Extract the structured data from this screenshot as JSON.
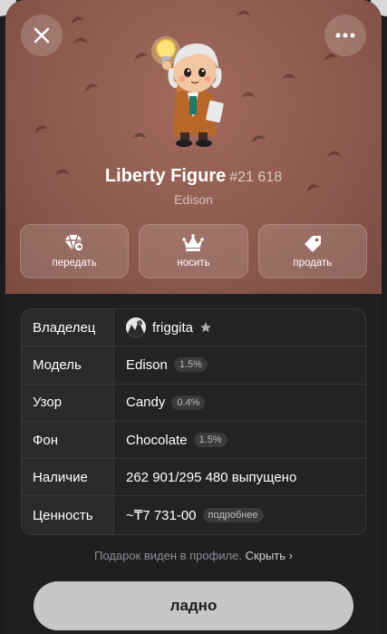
{
  "header": {
    "close_icon": "close-icon",
    "more_icon": "more-horizontal-icon"
  },
  "gift": {
    "title": "Liberty Figure",
    "number": "#21 618",
    "subtitle": "Edison",
    "background_color": "#8d5a4e"
  },
  "actions": [
    {
      "label": "передать",
      "icon": "diamond-send-icon"
    },
    {
      "label": "носить",
      "icon": "crown-icon"
    },
    {
      "label": "продать",
      "icon": "price-tag-icon"
    }
  ],
  "details": {
    "owner": {
      "key": "Владелец",
      "value": "friggita",
      "icon": "star-icon"
    },
    "model": {
      "key": "Модель",
      "value": "Edison",
      "pill": "1.5%"
    },
    "pattern": {
      "key": "Узор",
      "value": "Candy",
      "pill": "0.4%"
    },
    "backdrop": {
      "key": "Фон",
      "value": "Chocolate",
      "pill": "1.5%"
    },
    "availability": {
      "key": "Наличие",
      "value": "262 901/295 480 выпущено"
    },
    "value": {
      "key": "Ценность",
      "value": "~₸7 731-00",
      "pill": "подробнее"
    }
  },
  "footer": {
    "note": "Подарок виден в профиле.",
    "link": "Скрыть",
    "ok_label": "ладно"
  }
}
